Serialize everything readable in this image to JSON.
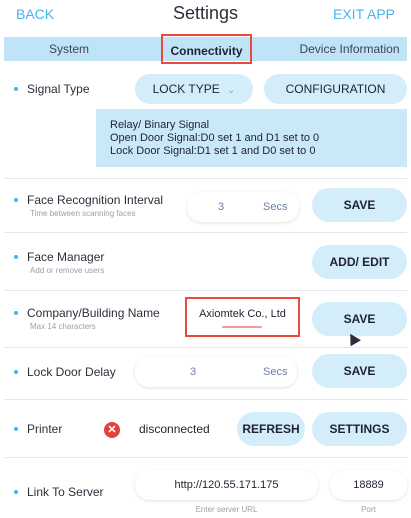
{
  "header": {
    "back": "BACK",
    "title": "Settings",
    "exit": "EXIT APP"
  },
  "tabs": [
    "System",
    "Connectivity",
    "Device Information"
  ],
  "signal_type": {
    "label": "Signal Type",
    "lock_type": "LOCK TYPE",
    "configuration": "CONFIGURATION",
    "info": [
      "Relay/ Binary Signal",
      "Open Door Signal:D0 set 1 and D1 set to 0",
      "Lock Door Signal:D1 set 1 and D0 set to 0"
    ]
  },
  "face_interval": {
    "label": "Face Recognition Interval",
    "sub": "Time between scanning faces",
    "value": "3",
    "unit": "Secs",
    "button": "SAVE"
  },
  "face_manager": {
    "label": "Face Manager",
    "sub": "Add or remove users",
    "button": "ADD/ EDIT"
  },
  "company": {
    "label": "Company/Building Name",
    "sub": "Max 14 characters",
    "value": "Axiomtek Co., Ltd",
    "button": "SAVE"
  },
  "lock_delay": {
    "label": "Lock Door Delay",
    "value": "3",
    "unit": "Secs",
    "button": "SAVE"
  },
  "printer": {
    "label": "Printer",
    "status": "disconnected",
    "status_icon": "error-x-icon",
    "refresh": "REFRESH",
    "settings": "SETTINGS"
  },
  "server": {
    "label": "Link To Server",
    "url": "http://120.55.171.175",
    "url_hint": "Enter server URL",
    "port": "18889",
    "port_hint": "Port"
  },
  "colors": {
    "accent": "#44b6ec",
    "tab_bar": "#bfe3f7",
    "pill": "#d4edfa",
    "highlight": "#e84a3c",
    "error": "#e0413a"
  }
}
